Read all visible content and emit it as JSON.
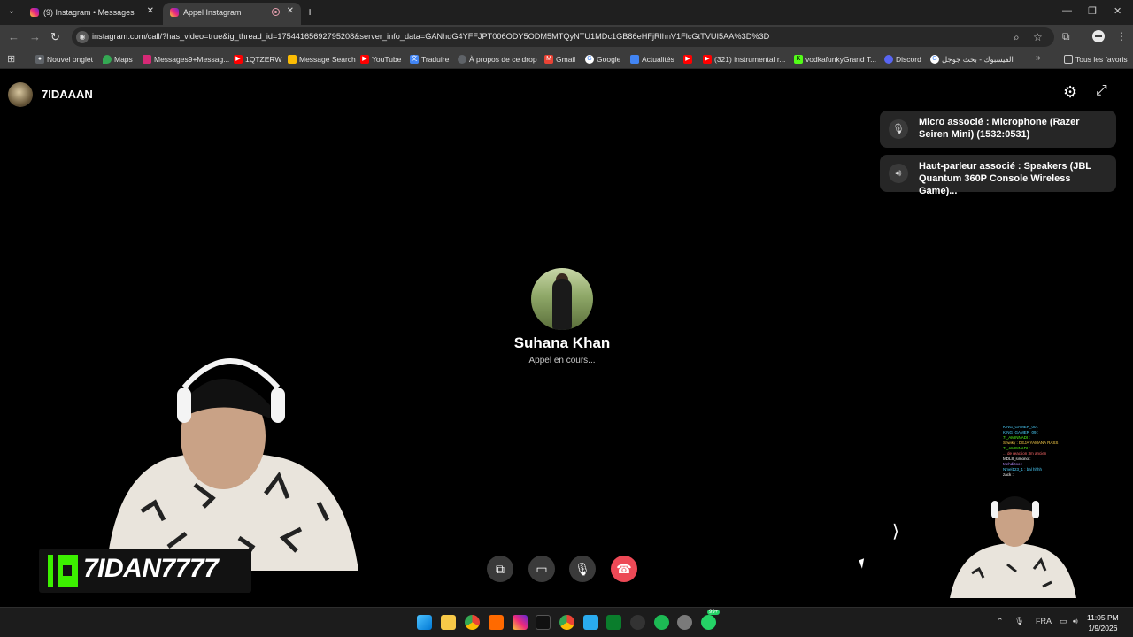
{
  "browser": {
    "tabs": [
      {
        "title": "(9) Instagram • Messages",
        "active": false
      },
      {
        "title": "Appel Instagram",
        "active": true
      }
    ],
    "url": "instagram.com/call/?has_video=true&ig_thread_id=17544165692795208&server_info_data=GANhdG4YFFJPT006ODY5ODM5MTQyNTU1MDc1GB86eHFjRlhnV1FlcGtTVUI5AA%3D%3D",
    "bookmarks": [
      {
        "label": "Nouvel onglet",
        "icon": "globe-icon",
        "color": "#9aa0a6"
      },
      {
        "label": "Maps",
        "icon": "maps-pin-icon",
        "color": "#34a853"
      },
      {
        "label": "Messages9+Messag...",
        "icon": "instagram-icon",
        "color": "#d62976"
      },
      {
        "label": "1QTZERW",
        "icon": "youtube-icon",
        "color": "#ff0000"
      },
      {
        "label": "Message Search",
        "icon": "chart-icon",
        "color": "#fbbc04"
      },
      {
        "label": "YouTube",
        "icon": "youtube-icon",
        "color": "#ff0000"
      },
      {
        "label": "Traduire",
        "icon": "translate-icon",
        "color": "#4285f4"
      },
      {
        "label": "À propos de ce drop",
        "icon": "globe-icon",
        "color": "#9aa0a6"
      },
      {
        "label": "Gmail",
        "icon": "gmail-icon",
        "color": "#ea4335"
      },
      {
        "label": "Google",
        "icon": "google-icon",
        "color": "#4285f4"
      },
      {
        "label": "Actualités",
        "icon": "news-icon",
        "color": "#4285f4"
      },
      {
        "label": "",
        "icon": "youtube-icon",
        "color": "#ff0000"
      },
      {
        "label": "(321) instrumental r...",
        "icon": "youtube-icon",
        "color": "#ff0000"
      },
      {
        "label": "vodkafunkyGrand T...",
        "icon": "kick-icon",
        "color": "#53fc18"
      },
      {
        "label": "Discord",
        "icon": "discord-icon",
        "color": "#5865f2"
      },
      {
        "label": "الفيسبوك - بحث جوجل",
        "icon": "google-icon",
        "color": "#4285f4"
      }
    ],
    "all_bookmarks_label": "Tous les favoris"
  },
  "call": {
    "caller_name": "7IDAAAN",
    "callee_name": "Suhana Khan",
    "status": "Appel en cours...",
    "devices": [
      {
        "icon": "microphone-icon",
        "text": "Micro associé : Microphone (Razer Seiren Mini) (1532:0531)"
      },
      {
        "icon": "speaker-icon",
        "text": "Haut-parleur associé : Speakers (JBL Quantum 360P Console Wireless Game)..."
      }
    ],
    "controls": [
      "screen-share",
      "camera",
      "microphone",
      "end-call"
    ]
  },
  "overlay": {
    "brand_text": "7IDAN7777",
    "brand_color": "#3cf000"
  },
  "mini_chat": [
    "KING_GAMER_00 :",
    "KING_GAMER_09 :",
    "7I_AMINNADI :",
    "Shwiky : DEJA YAMANA RASS",
    "7I_AMINNADI :",
    "... de reaction 3m ancien",
    "MDL8_simono :",
    "Mehdiitoo :",
    "Nmel123_1 : bal hhhh",
    "zack :"
  ],
  "taskbar": {
    "language": "FRA",
    "time": "11:05 PM",
    "date": "1/9/2026",
    "badge_count": "99+"
  }
}
